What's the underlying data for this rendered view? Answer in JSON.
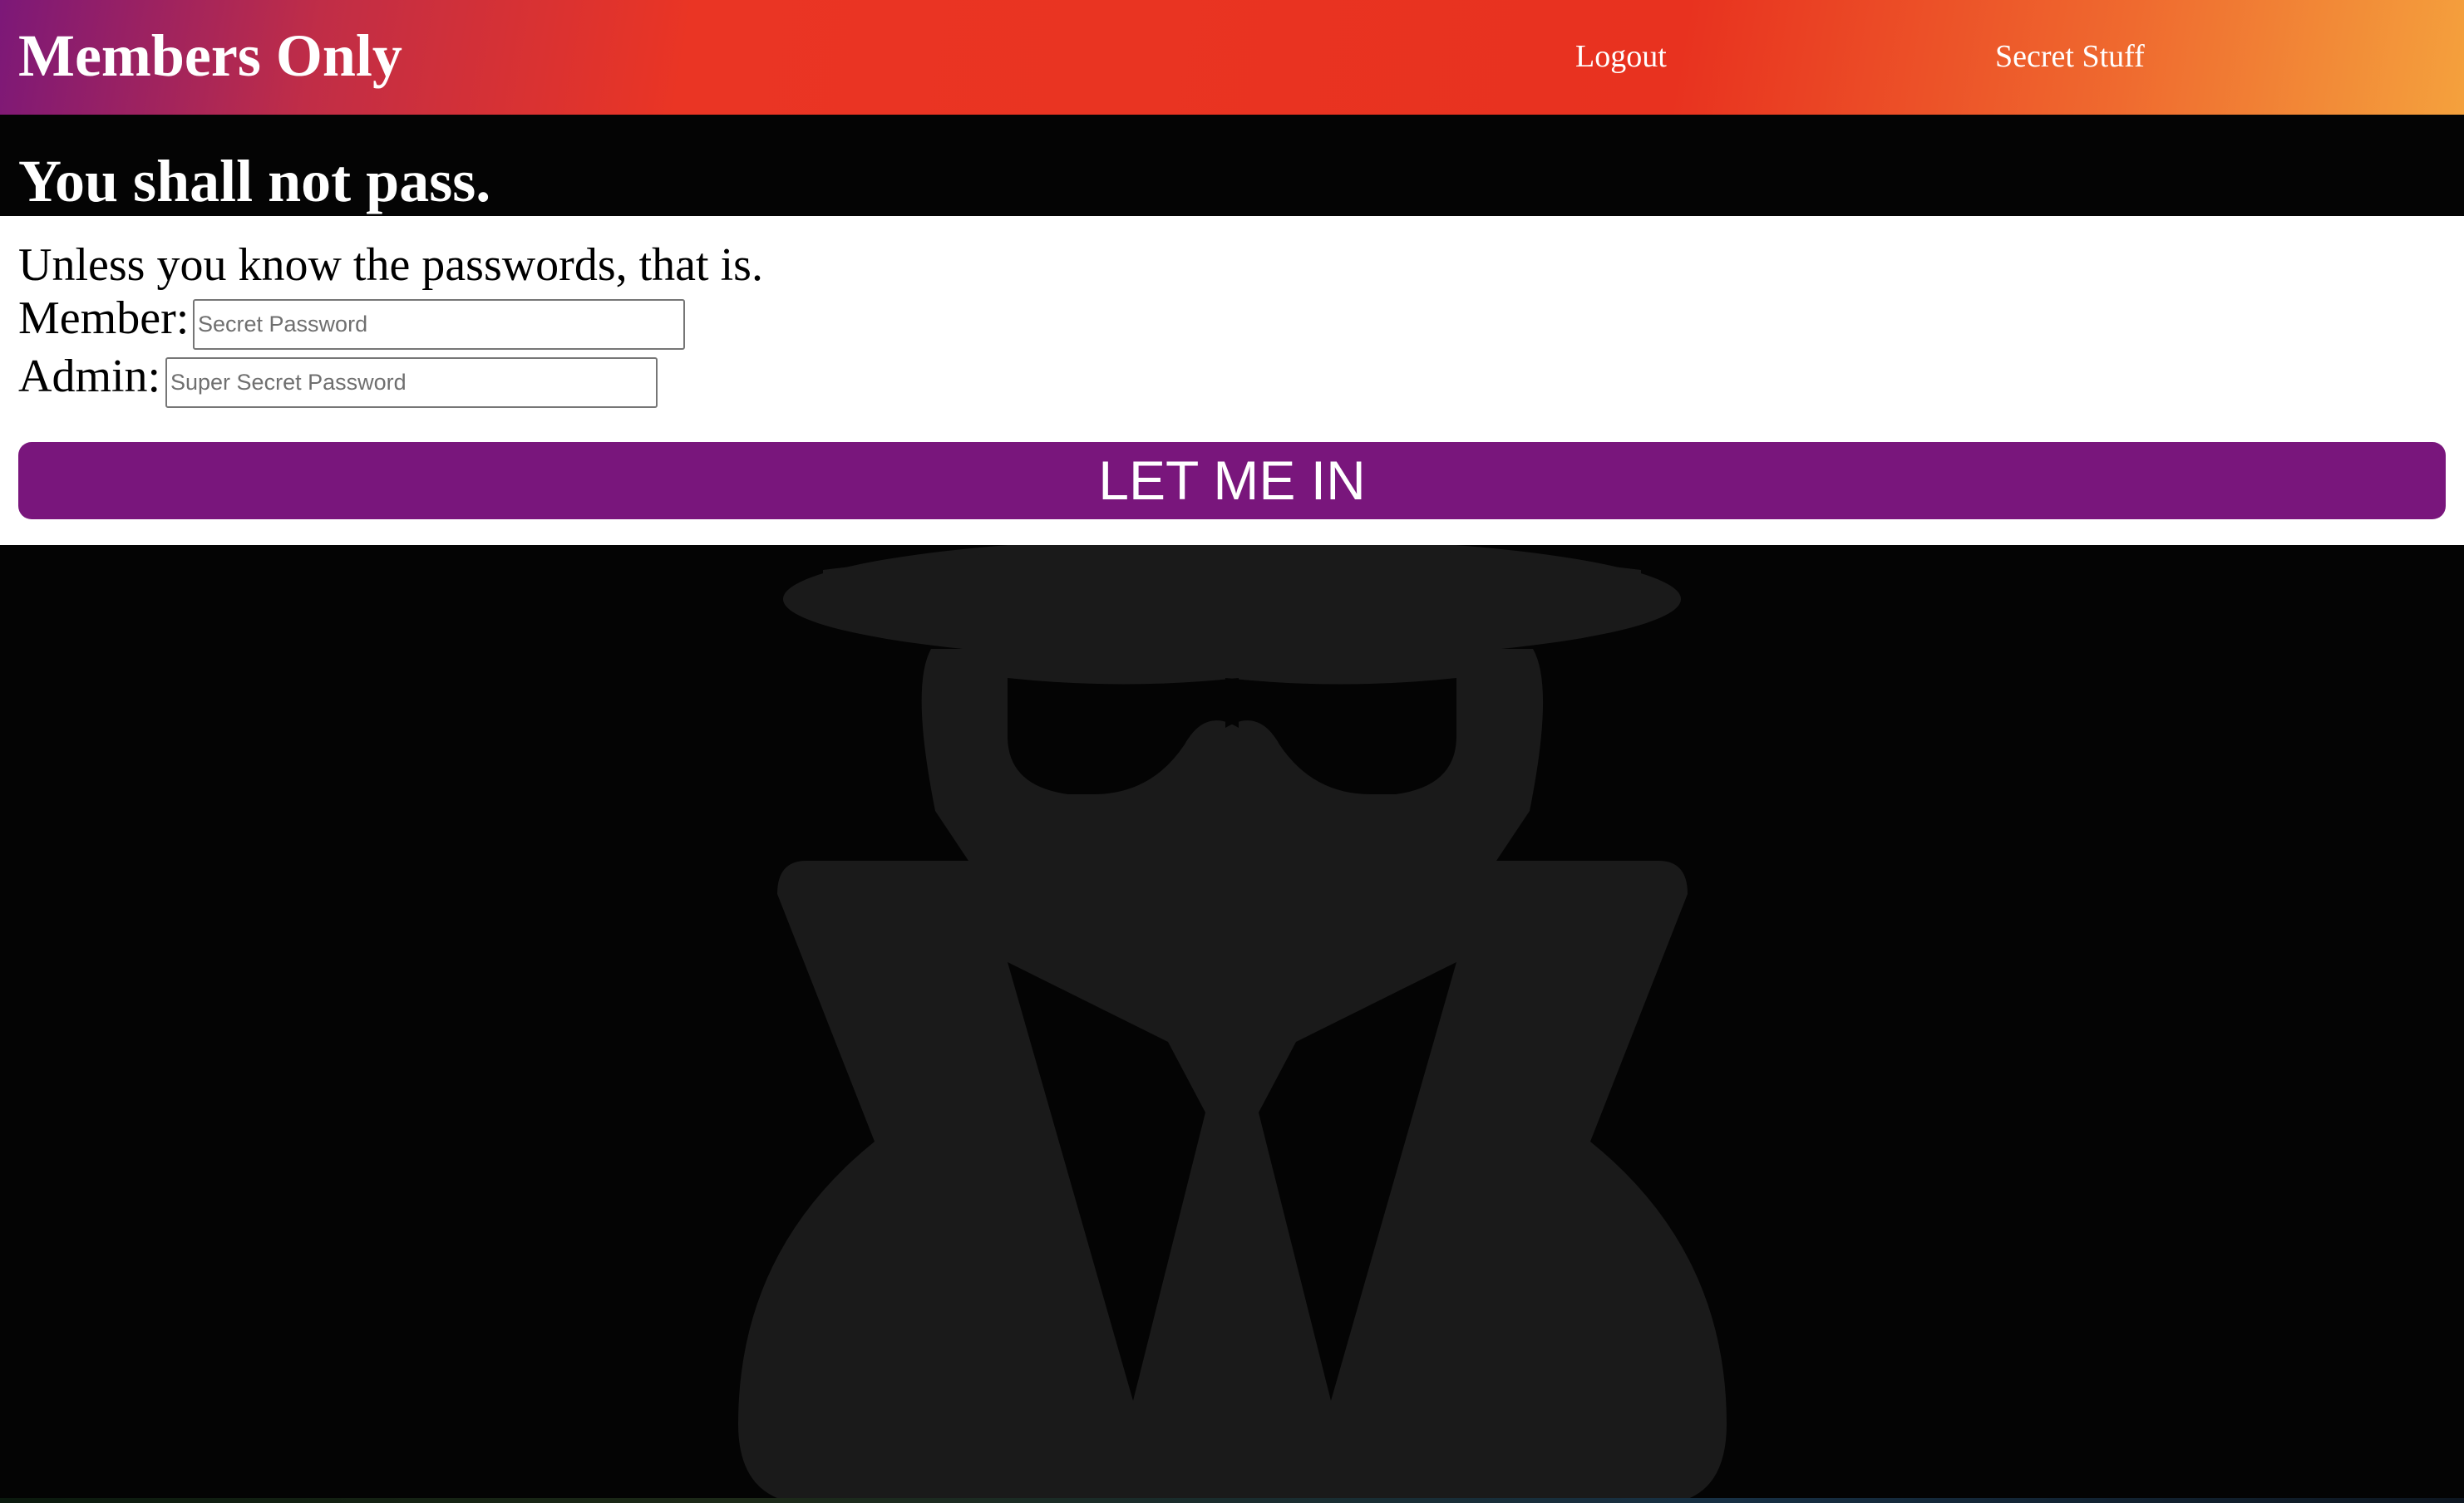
{
  "header": {
    "brand": "Members Only",
    "nav": {
      "logout_label": "Logout",
      "secret_label": "Secret Stuff"
    }
  },
  "main": {
    "heading": "You shall not pass.",
    "subtitle": "Unless you know the passwords, that is."
  },
  "form": {
    "member_label": "Member:",
    "member_placeholder": "Secret Password",
    "member_value": "",
    "admin_label": "Admin:",
    "admin_placeholder": "Super Secret Password",
    "admin_value": "",
    "submit_label": "LET ME IN"
  },
  "illustration": {
    "icon": "user-secret-icon",
    "color": "#1a1a1a"
  },
  "colors": {
    "button": "#79167c",
    "header_gradient": [
      "#7c1878",
      "#e8321f",
      "#f4a13d"
    ],
    "background": "#040404"
  }
}
